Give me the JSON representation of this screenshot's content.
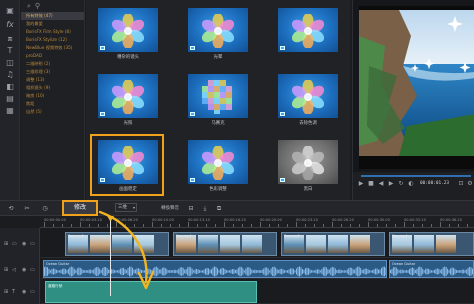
{
  "left_rail": {
    "icons": [
      "media-icon",
      "fx-icon",
      "transition-icon",
      "text-icon",
      "overlay-icon",
      "audio-icon",
      "element-icon",
      "split-icon",
      "template-icon"
    ]
  },
  "categories": {
    "header_icon": "fx-icon",
    "items": [
      {
        "label": "所有特效 (47)",
        "active": true
      },
      {
        "label": "我的最愛",
        "active": false
      },
      {
        "label": "BorisFX Film Style (8)",
        "active": false
      },
      {
        "label": "BorisFX Stylize (12)",
        "active": false
      },
      {
        "label": "NewBlue 视频特效 (35)",
        "active": false
      },
      {
        "label": "proDAD",
        "active": false
      },
      {
        "label": "二维映射 (2)",
        "active": false
      },
      {
        "label": "三维纹理 (3)",
        "active": false
      },
      {
        "label": "调整 (13)",
        "active": false
      },
      {
        "label": "相机镜头 (9)",
        "active": false
      },
      {
        "label": "暗房 (10)",
        "active": false
      },
      {
        "label": "焦距",
        "active": false
      },
      {
        "label": "自然 (5)",
        "active": false
      }
    ]
  },
  "gallery": {
    "tiles": [
      {
        "label": "嘈杂的镜头",
        "style": "blue",
        "selected": false
      },
      {
        "label": "光晕",
        "style": "blue",
        "selected": false
      },
      {
        "label": "",
        "style": "blue",
        "selected": false
      },
      {
        "label": "光照",
        "style": "blue",
        "selected": false
      },
      {
        "label": "马赛克",
        "style": "mosaic",
        "selected": false
      },
      {
        "label": "去除色调",
        "style": "blue",
        "selected": false
      },
      {
        "label": "画面稳定",
        "style": "blue",
        "selected": true
      },
      {
        "label": "色彩调整",
        "style": "blue",
        "selected": false
      },
      {
        "label": "黑白",
        "style": "gray",
        "selected": false
      }
    ]
  },
  "preview": {
    "timecode": "00:00:01.23"
  },
  "timeline_toolbar": {
    "modify_label": "修改",
    "combo_value": "三维",
    "sound_label": "轉換聲音",
    "buttons": [
      "undo-icon",
      "scissors-icon",
      "clock-icon"
    ]
  },
  "ruler": {
    "ticks": [
      "00:00:00.00",
      "00:00:03.10",
      "00:00:06.20",
      "00:00:10.00",
      "00:00:13.10",
      "00:00:16.20",
      "00:00:20.00",
      "00:00:23.10",
      "00:00:26.20",
      "00:00:30.00",
      "00:00:33.10",
      "00:00:36.20"
    ]
  },
  "tracks": {
    "video_clips": [
      {
        "name": "Sea.mp4"
      },
      {
        "name": "Sea.mp4"
      },
      {
        "name": "Sea.mp4"
      },
      {
        "name": "Sea.mp4"
      }
    ],
    "audio_clip_name": "Ocean Guitar",
    "title_clip_name": "道路行驶"
  },
  "colors": {
    "accent": "#f0a21c",
    "video_clip": "#3b5670",
    "audio_clip": "#2b5a85",
    "title_clip": "#2f8f83"
  }
}
